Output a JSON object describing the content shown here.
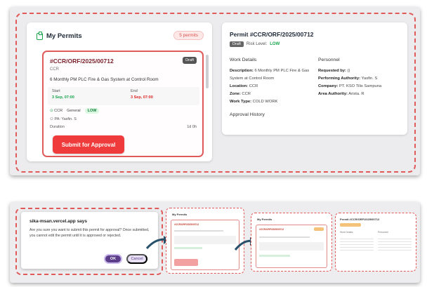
{
  "top": {
    "my_permits_title": "My Permits",
    "permits_count": "5 permits",
    "permit": {
      "number": "#CCR/ORF/2025/00712",
      "status": "Draft",
      "zone": "CCR",
      "description": "6 Monthly PM PLC Fire & Gas System at Control Room",
      "start_label": "Start",
      "start_value": "3 Sep, 07:00",
      "end_label": "End",
      "end_value": "3 Sep, 07:00",
      "zone_tag": "CCR",
      "work_type_tag": "General",
      "risk_tag": "LOW",
      "by_label": "PA: Yasfin. S",
      "duration_label": "Duration",
      "duration_value": "1d 0h",
      "submit_label": "Submit for Approval"
    },
    "detail": {
      "title": "Permit #CCR/ORF/2025/00712",
      "status": "Draft",
      "risk_label": "Risk Level:",
      "risk_value": "LOW",
      "work_details_heading": "Work Details",
      "personnel_heading": "Personnel",
      "description_label": "Description:",
      "description_value": "6 Monthly PM PLC Fire & Gas System at Control Room",
      "location_label": "Location:",
      "location_value": "CCR",
      "zone_label": "Zone:",
      "zone_value": "CCR",
      "work_type_label": "Work Type:",
      "work_type_value": "COLD WORK",
      "requested_by_label": "Requested by:",
      "requested_by_value": "()",
      "performing_label": "Performing Authority:",
      "performing_value": "Yasfin. S",
      "company_label": "Company:",
      "company_value": "PT. KSO Tilis Sampuna",
      "area_label": "Area Authority:",
      "area_value": "Arista. R",
      "approval_history": "Approval History"
    }
  },
  "bottom": {
    "dialog_title": "sika-msan.vercel.app says",
    "dialog_message": "Are you sure you want to submit this permit for approval? Once submitted, you cannot edit the permit until it is approved or rejected.",
    "ok_label": "OK",
    "cancel_label": "Cancel",
    "mini1_title": "My Permits",
    "mini1_permit": "#CCR/ORF/2025/00712",
    "mini2_title": "My Permits",
    "mini2_permit": "#CCR/ORF/2025/00712",
    "mini3_title": "Permit #CCR/ORF/2025/00712",
    "mini3_work": "Work Details",
    "mini3_personnel": "Personnel"
  },
  "colors": {
    "accent_red": "#ef3b3b",
    "outline_red": "#e05a5a",
    "low_green": "#16a34a",
    "ok_purple": "#5b3d8a"
  }
}
